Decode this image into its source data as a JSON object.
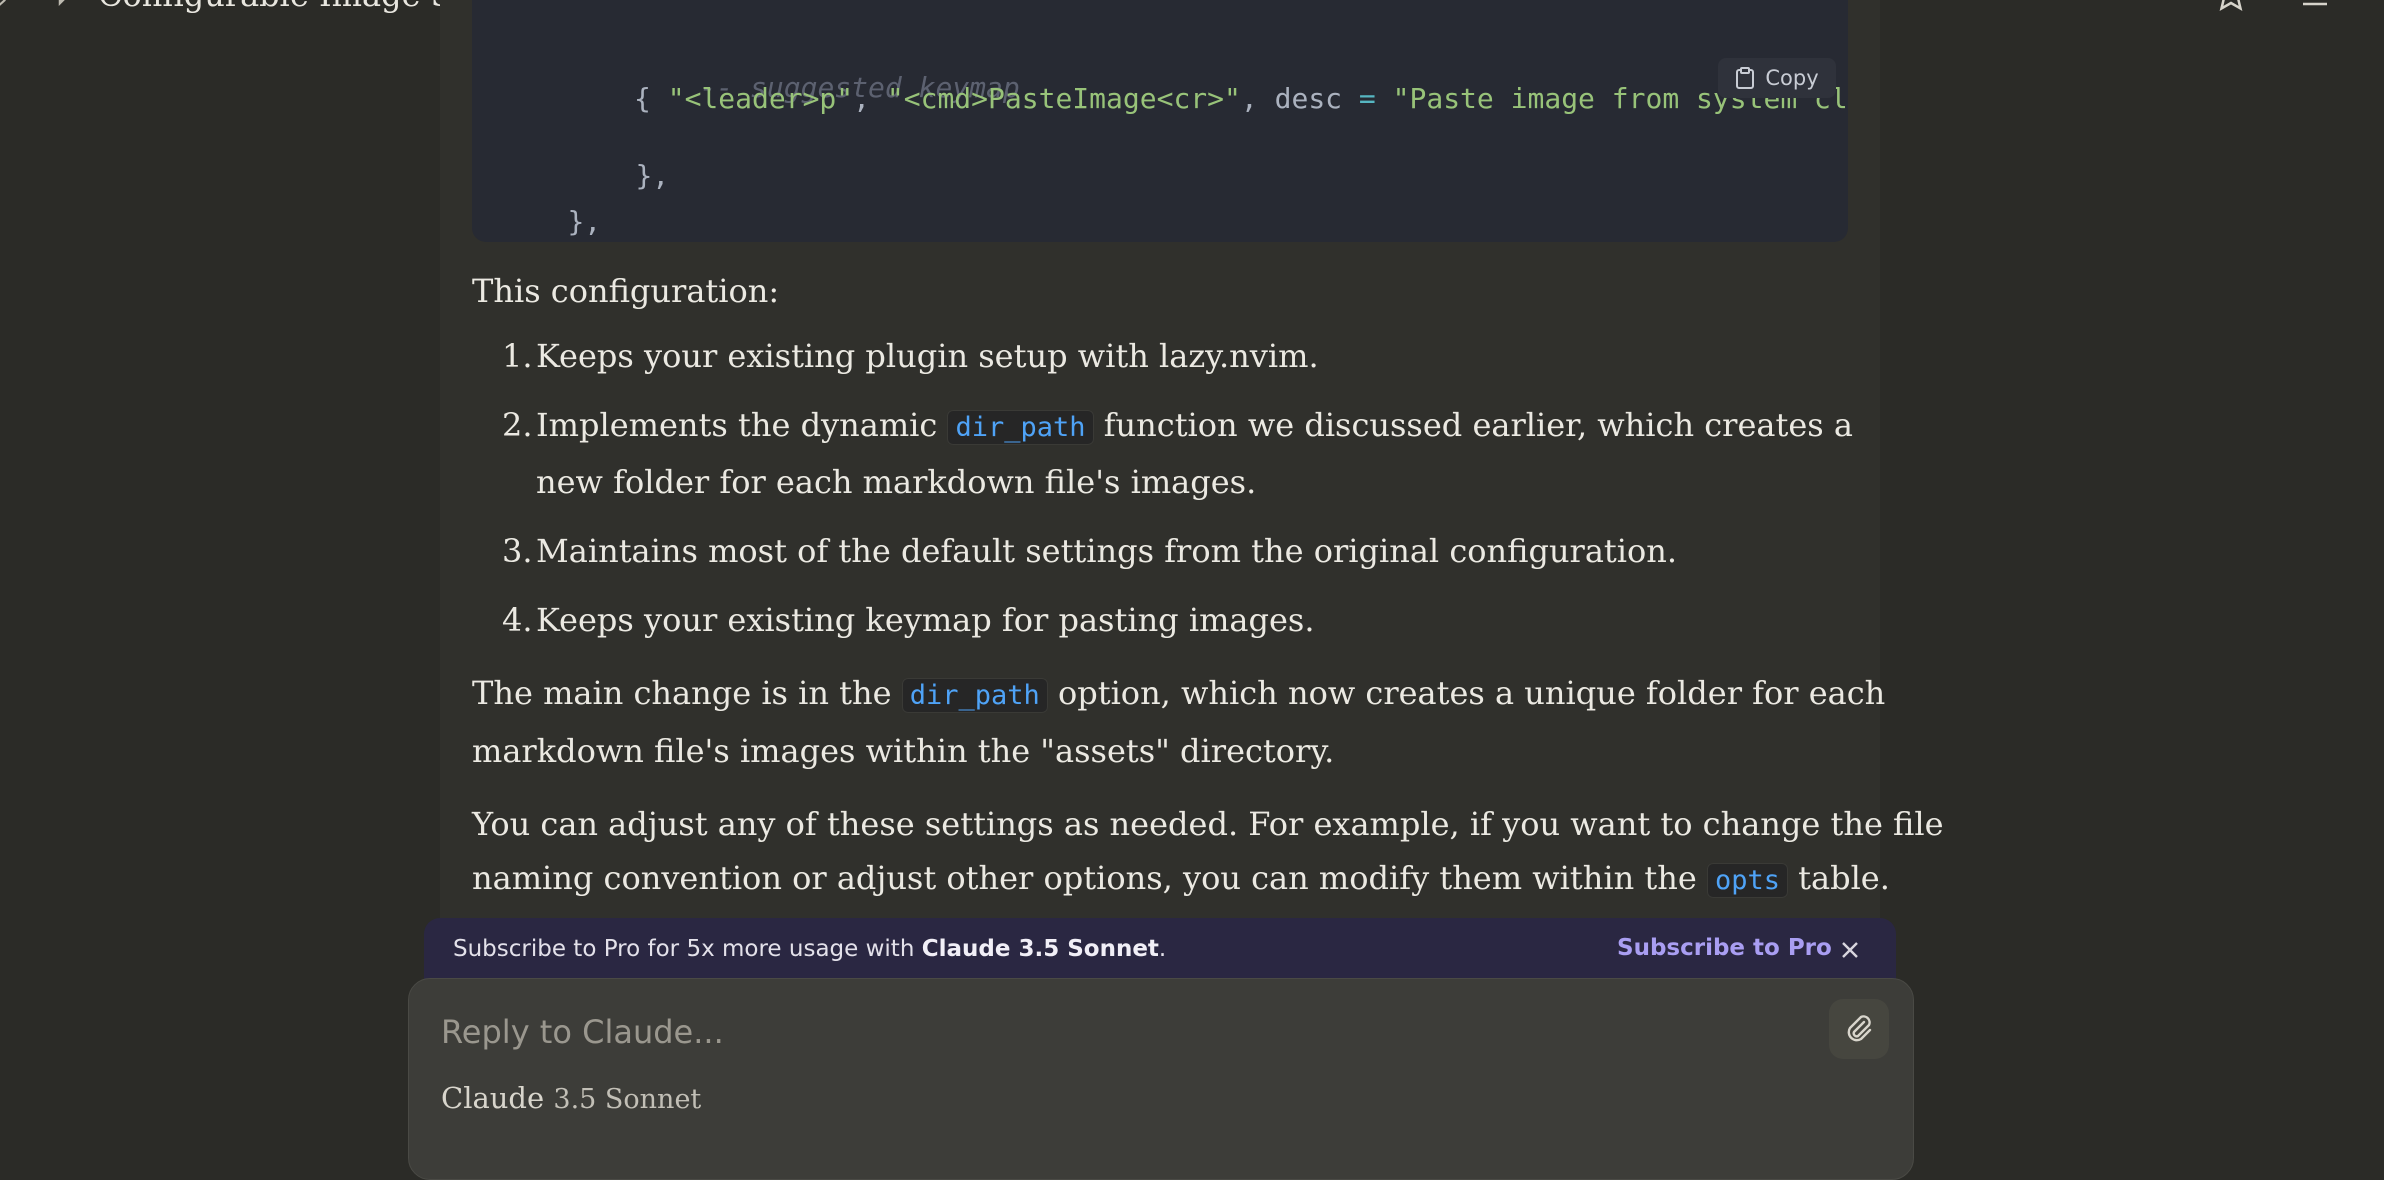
{
  "header": {
    "title": "Configurable Image Storage for Markdown Files"
  },
  "code": {
    "copy_label": "Copy",
    "lines": [
      {
        "comment": "-- suggested keymap"
      },
      {
        "open": "{ ",
        "s1": "\"<leader>p\"",
        "c1": ", ",
        "s2": "\"<cmd>PasteImage<cr>\"",
        "c2": ", desc ",
        "op": "=",
        "sp": " ",
        "s3": "\"Paste image from system cli"
      },
      {
        "text": "},"
      },
      {
        "text": "},"
      }
    ]
  },
  "message": {
    "intro": "This configuration:",
    "items": [
      {
        "num": "1.",
        "text": "Keeps your existing plugin setup with lazy.nvim."
      },
      {
        "num": "2.",
        "pre": "Implements the dynamic",
        "code": "dir_path",
        "post": "function we discussed earlier, which creates a",
        "cont": "new folder for each markdown file's images."
      },
      {
        "num": "3.",
        "text": "Maintains most of the default settings from the original configuration."
      },
      {
        "num": "4.",
        "text": "Keeps your existing keymap for pasting images."
      }
    ],
    "p2": {
      "pre": "The main change is in the",
      "code": "dir_path",
      "post": "option, which now creates a unique folder for each",
      "line2": "markdown file's images within the \"assets\" directory."
    },
    "p3": {
      "line1": "You can adjust any of these settings as needed. For example, if you want to change the file",
      "pre": "naming convention or adjust other options, you can modify them within the",
      "code": "opts",
      "post": "table."
    }
  },
  "banner": {
    "pre": "Subscribe to Pro for 5x more usage with",
    "bold": "Claude 3.5 Sonnet",
    "dot": ".",
    "button": "Subscribe to Pro"
  },
  "composer": {
    "placeholder": "Reply to Claude...",
    "model_name": "Claude",
    "model_version": "3.5 Sonnet"
  },
  "colors": {
    "background": "#2b2b27",
    "code_bg": "#272a33",
    "inline_code": "#4fa3f7",
    "banner_bg": "#2a2742",
    "banner_accent": "#a99ef2"
  },
  "icons": [
    "chat-bubble-icon",
    "star-icon",
    "menu-icon",
    "clipboard-icon",
    "close-icon",
    "paperclip-icon"
  ]
}
